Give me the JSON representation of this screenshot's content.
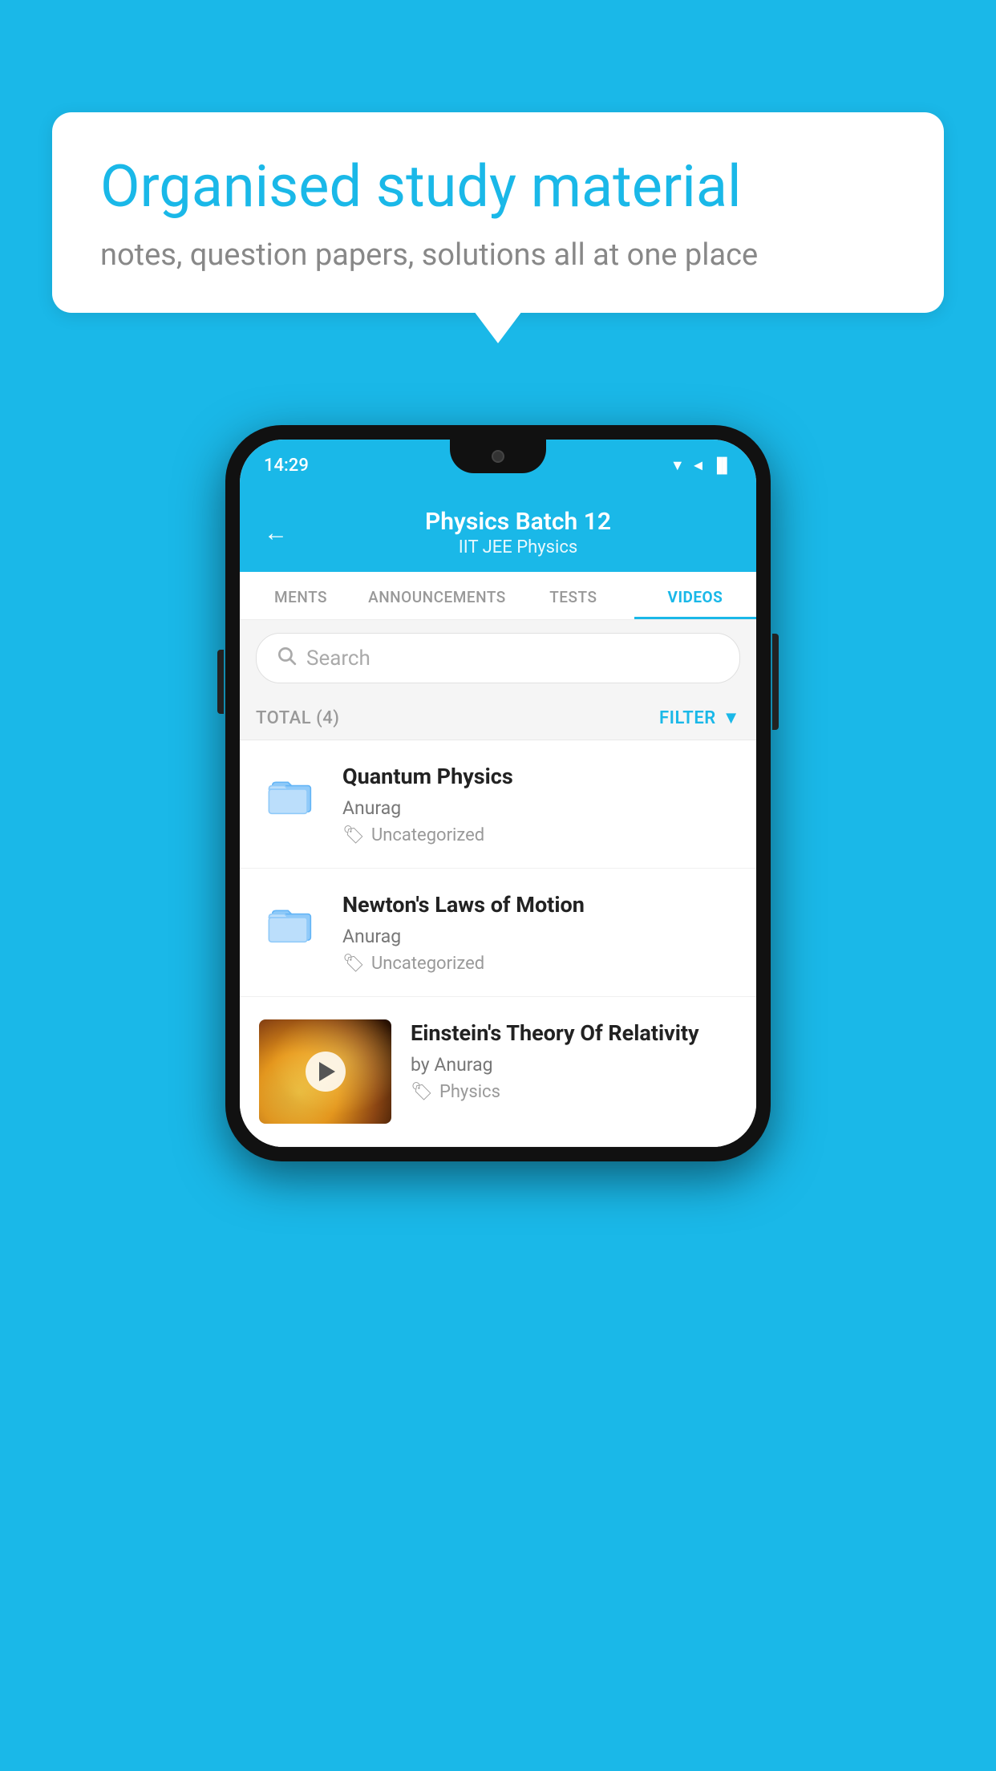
{
  "background": {
    "color": "#1ab8e8"
  },
  "speech_bubble": {
    "title": "Organised study material",
    "subtitle": "notes, question papers, solutions all at one place"
  },
  "phone": {
    "status_bar": {
      "time": "14:29",
      "icons": "▼ ◄ ▐"
    },
    "header": {
      "back_label": "←",
      "title": "Physics Batch 12",
      "tags": "IIT JEE   Physics"
    },
    "tabs": [
      {
        "label": "MENTS",
        "active": false
      },
      {
        "label": "ANNOUNCEMENTS",
        "active": false
      },
      {
        "label": "TESTS",
        "active": false
      },
      {
        "label": "VIDEOS",
        "active": true
      }
    ],
    "search": {
      "placeholder": "Search"
    },
    "filter_bar": {
      "total_label": "TOTAL (4)",
      "filter_label": "FILTER"
    },
    "videos": [
      {
        "title": "Quantum Physics",
        "author": "Anurag",
        "tag": "Uncategorized",
        "type": "folder",
        "has_thumb": false
      },
      {
        "title": "Newton's Laws of Motion",
        "author": "Anurag",
        "tag": "Uncategorized",
        "type": "folder",
        "has_thumb": false
      },
      {
        "title": "Einstein's Theory Of Relativity",
        "author": "by Anurag",
        "tag": "Physics",
        "type": "video",
        "has_thumb": true
      }
    ]
  }
}
